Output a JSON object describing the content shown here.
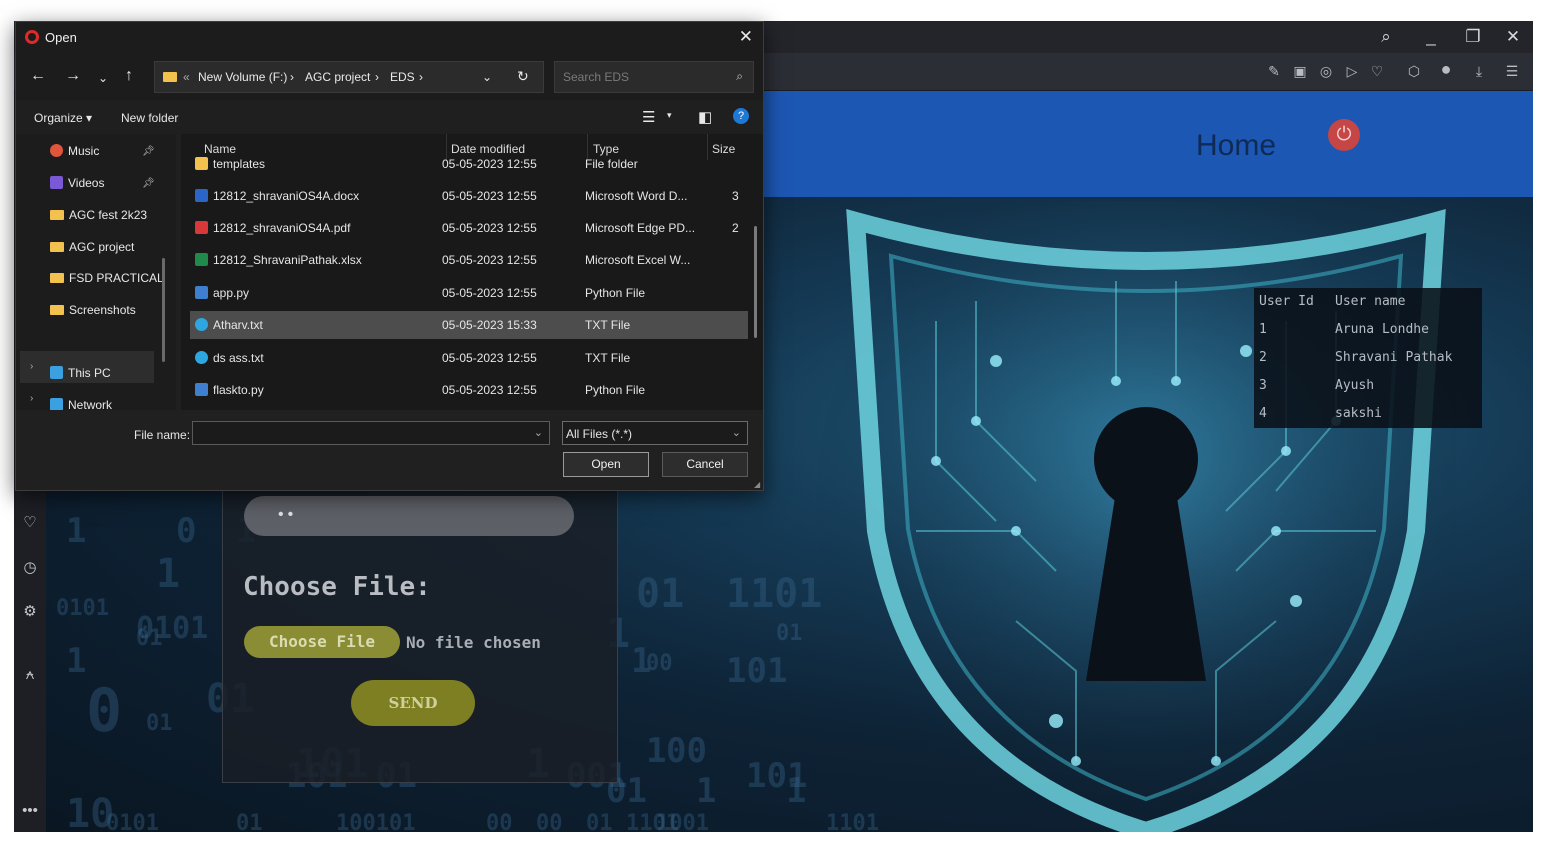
{
  "browser": {
    "toolbar_icons": [
      "search-icon",
      "minimize-icon",
      "restore-icon",
      "close-icon"
    ],
    "sidebar_icons": [
      "heart-icon",
      "history-icon",
      "settings-icon",
      "lightbulb-icon",
      "more-icon"
    ],
    "more_label": "•••"
  },
  "page": {
    "home_label": "Home",
    "password_dots": "••",
    "choose_heading": "Choose File:",
    "choose_button": "Choose File",
    "no_file_text": "No file chosen",
    "send_button": "SEND",
    "binary_texts": [
      "1",
      "0",
      "1",
      "01",
      "0101",
      "01",
      "1101",
      "01",
      "1",
      "101",
      "1",
      "0",
      "01",
      "1",
      "101",
      "1",
      "00",
      "01",
      "1",
      "1",
      "10",
      "01",
      "1",
      "00",
      "1",
      "101",
      "01",
      "001",
      "101",
      "1101",
      "0101",
      "01",
      "100101",
      "00",
      "00",
      "01",
      "1001",
      "1101",
      "0101"
    ],
    "users_table": {
      "headers": [
        "User Id",
        "User name"
      ],
      "rows": [
        {
          "id": "1",
          "name": "Aruna Londhe"
        },
        {
          "id": "2",
          "name": "Shravani Pathak"
        },
        {
          "id": "3",
          "name": "Ayush"
        },
        {
          "id": "4",
          "name": "sakshi"
        }
      ]
    },
    "accent_colors": {
      "header": "#1d57b4",
      "button": "#8b8d35",
      "power": "#c64545"
    }
  },
  "dialog": {
    "title": "Open",
    "close_glyph": "✕",
    "breadcrumb": [
      "New Volume (F:)",
      "AGC project",
      "EDS"
    ],
    "search_placeholder": "Search EDS",
    "organize": "Organize ▾",
    "new_folder": "New folder",
    "nav_items": [
      {
        "label": "Music",
        "pinned": true
      },
      {
        "label": "Videos",
        "pinned": true
      },
      {
        "label": "AGC fest 2k23",
        "pinned": false
      },
      {
        "label": "AGC project",
        "pinned": false
      },
      {
        "label": "FSD PRACTICAL",
        "pinned": false
      },
      {
        "label": "Screenshots",
        "pinned": false
      },
      {
        "label": "This PC",
        "pinned": false
      },
      {
        "label": "Network",
        "pinned": false
      }
    ],
    "columns": [
      "Name",
      "Date modified",
      "Type",
      "Size"
    ],
    "files": [
      {
        "name": "templates",
        "date": "05-05-2023 12:55",
        "type": "File folder",
        "size": "",
        "icon": "folder-icon"
      },
      {
        "name": "12812_shravaniOS4A.docx",
        "date": "05-05-2023 12:55",
        "type": "Microsoft Word D...",
        "size": "3",
        "icon": "word-icon"
      },
      {
        "name": "12812_shravaniOS4A.pdf",
        "date": "05-05-2023 12:55",
        "type": "Microsoft Edge PD...",
        "size": "2",
        "icon": "pdf-icon"
      },
      {
        "name": "12812_ShravaniPathak.xlsx",
        "date": "05-05-2023 12:55",
        "type": "Microsoft Excel W...",
        "size": "",
        "icon": "excel-icon"
      },
      {
        "name": "app.py",
        "date": "05-05-2023 12:55",
        "type": "Python File",
        "size": "",
        "icon": "python-icon"
      },
      {
        "name": "Atharv.txt",
        "date": "05-05-2023 15:33",
        "type": "TXT File",
        "size": "",
        "icon": "edge-icon"
      },
      {
        "name": "ds ass.txt",
        "date": "05-05-2023 12:55",
        "type": "TXT File",
        "size": "",
        "icon": "edge-icon"
      },
      {
        "name": "flaskto.py",
        "date": "05-05-2023 12:55",
        "type": "Python File",
        "size": "",
        "icon": "python-icon"
      }
    ],
    "selected_index": 5,
    "file_name_label": "File name:",
    "file_name_value": "",
    "filter": "All Files (*.*)",
    "open_button": "Open",
    "cancel_button": "Cancel"
  }
}
